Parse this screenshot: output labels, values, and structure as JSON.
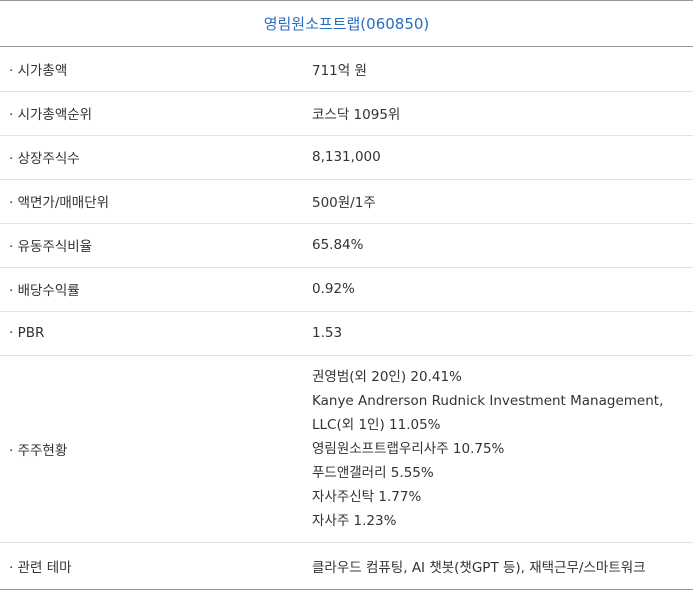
{
  "header": {
    "title": "영림원소프트랩(060850)"
  },
  "rows": [
    {
      "label": "· 시가총액",
      "value": "711억 원"
    },
    {
      "label": "· 시가총액순위",
      "value": "코스닥 1095위"
    },
    {
      "label": "· 상장주식수",
      "value": "8,131,000"
    },
    {
      "label": "· 액면가/매매단위",
      "value": "500원/1주"
    },
    {
      "label": "· 유동주식비율",
      "value": "65.84%"
    },
    {
      "label": "· 배당수익률",
      "value": "0.92%"
    },
    {
      "label": "· PBR",
      "value": "1.53"
    }
  ],
  "shareholders": {
    "label": "· 주주현황",
    "lines": [
      "권영범(외 20인) 20.41%",
      "Kanye Andrerson Rudnick Investment Management,",
      "LLC(외 1인) 11.05%",
      "영림원소프트랩우리사주 10.75%",
      "푸드앤갤러리 5.55%",
      "자사주신탁 1.77%",
      "자사주 1.23%"
    ]
  },
  "theme": {
    "label": "· 관련 테마",
    "value": "클라우드 컴퓨팅, AI 챗봇(챗GPT 등), 재택근무/스마트워크"
  }
}
